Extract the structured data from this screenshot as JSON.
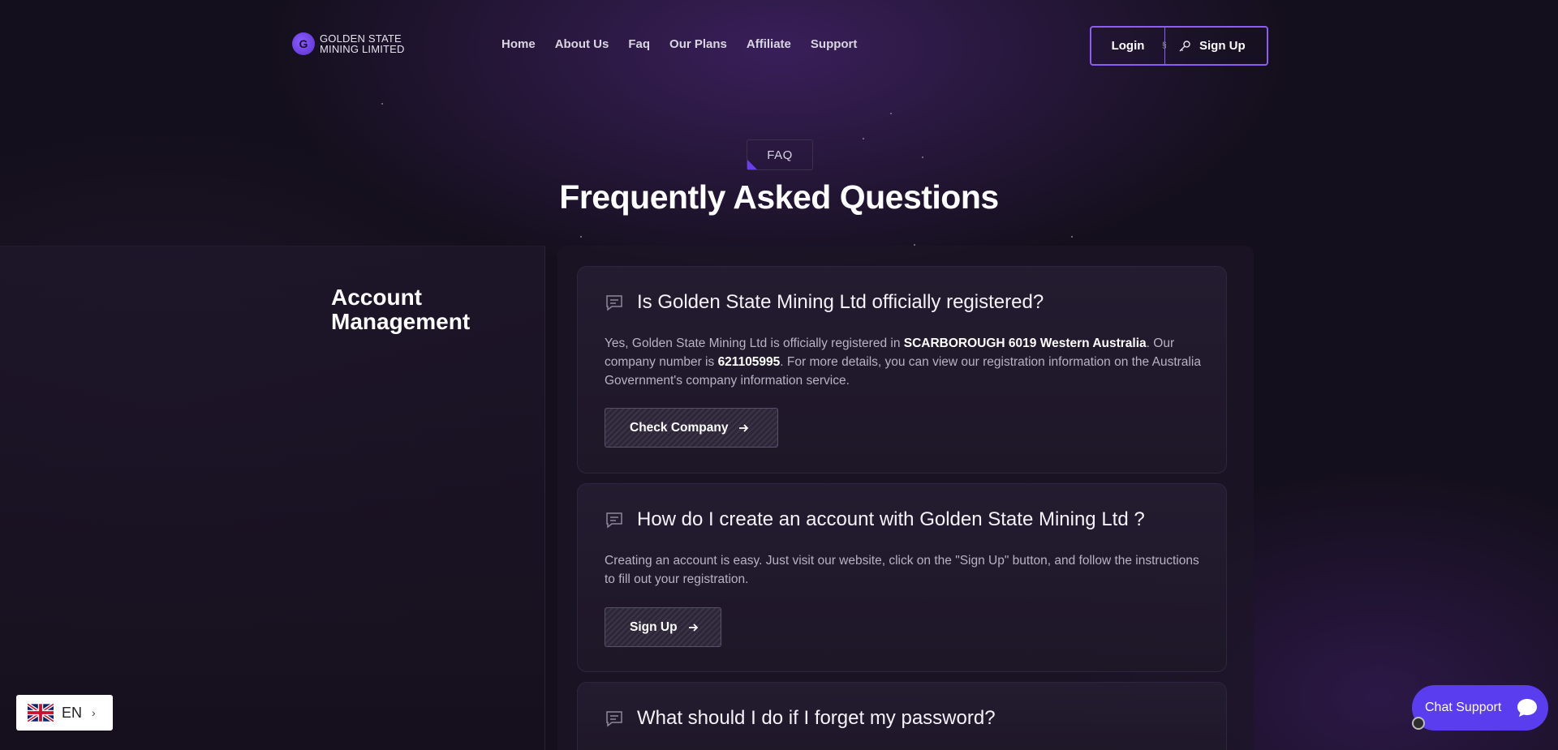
{
  "brand": {
    "logo_letter": "G",
    "name_line1": "GOLDEN STATE",
    "name_line2": "MINING LIMITED"
  },
  "nav": {
    "items": [
      "Home",
      "About Us",
      "Faq",
      "Our Plans",
      "Affiliate",
      "Support"
    ]
  },
  "auth": {
    "login_label": "Login",
    "divider_glyph": "§",
    "signup_label": "Sign Up"
  },
  "hero": {
    "tag": "FAQ",
    "title": "Frequently Asked Questions"
  },
  "category": {
    "title": "Account Management"
  },
  "faqs": [
    {
      "question": "Is Golden State Mining Ltd officially registered?",
      "answer_parts": [
        "Yes, Golden State Mining Ltd is officially registered in ",
        "SCARBOROUGH 6019 Western Australia",
        ". Our company number is ",
        "621105995",
        ". For more details, you can view our registration information on the Australia Government's company information service."
      ],
      "button_label": "Check Company"
    },
    {
      "question": "How do I create an account with Golden State Mining Ltd ?",
      "answer": "Creating an account is easy. Just visit our website, click on the \"Sign Up\" button, and follow the instructions to fill out your registration.",
      "button_label": "Sign Up"
    },
    {
      "question": "What should I do if I forget my password?"
    }
  ],
  "language": {
    "code": "EN"
  },
  "chat": {
    "label": "Chat Support"
  },
  "colors": {
    "accent": "#8b5cf6",
    "chat": "#5b3df0",
    "background": "#140f1c"
  }
}
